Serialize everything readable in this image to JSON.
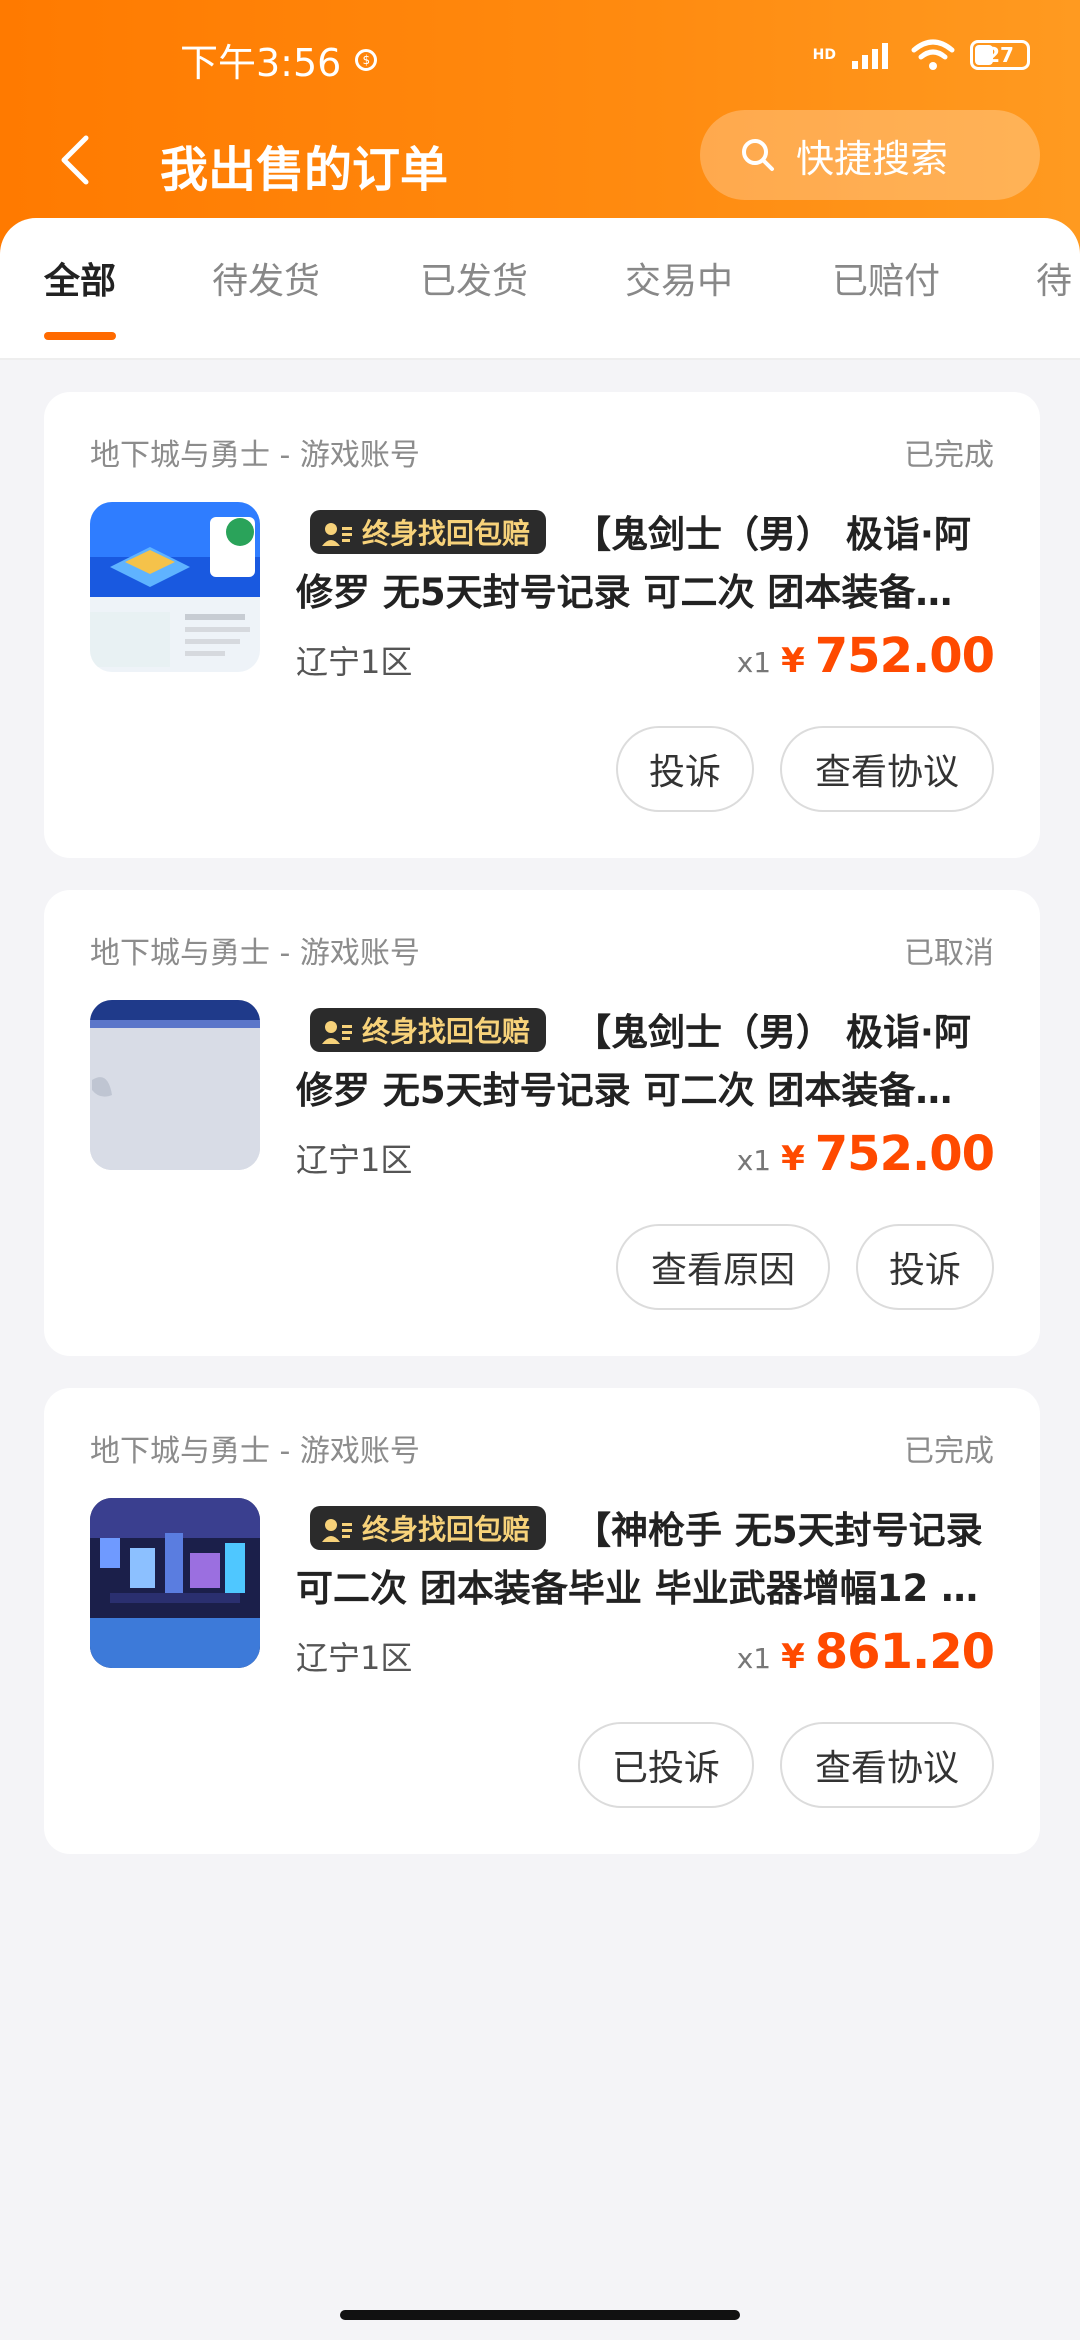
{
  "status_bar": {
    "time": "下午3:56",
    "hd": "HD",
    "battery": "27"
  },
  "header": {
    "title": "我出售的订单",
    "search_placeholder": "快捷搜索"
  },
  "tabs": [
    {
      "label": "全部",
      "active": true
    },
    {
      "label": "待发货",
      "active": false
    },
    {
      "label": "已发货",
      "active": false
    },
    {
      "label": "交易中",
      "active": false
    },
    {
      "label": "已赔付",
      "active": false
    },
    {
      "label": "待",
      "active": false
    }
  ],
  "orders": [
    {
      "game": "地下城与勇士 - 游戏账号",
      "status": "已完成",
      "badge": "终身找回包赔",
      "title_line1": "【鬼剑士（男） 极诣·阿",
      "title_line2": "修罗 无5天封号记录 可二次 团本装备…",
      "region": "辽宁1区",
      "qty": "x1",
      "currency": "¥",
      "price": "752.00",
      "buttons": [
        "投诉",
        "查看协议"
      ]
    },
    {
      "game": "地下城与勇士 - 游戏账号",
      "status": "已取消",
      "badge": "终身找回包赔",
      "title_line1": "【鬼剑士（男） 极诣·阿",
      "title_line2": "修罗 无5天封号记录 可二次 团本装备…",
      "region": "辽宁1区",
      "qty": "x1",
      "currency": "¥",
      "price": "752.00",
      "buttons": [
        "查看原因",
        "投诉"
      ]
    },
    {
      "game": "地下城与勇士 - 游戏账号",
      "status": "已完成",
      "badge": "终身找回包赔",
      "title_line1": "【神枪手 无5天封号记录",
      "title_line2": "可二次 团本装备毕业 毕业武器增幅12 …",
      "region": "辽宁1区",
      "qty": "x1",
      "currency": "¥",
      "price": "861.20",
      "buttons": [
        "已投诉",
        "查看协议"
      ]
    }
  ],
  "colors": {
    "brand_orange": "#ff7a00",
    "price_red": "#ff4a00",
    "tab_underline": "#ff6a00"
  }
}
